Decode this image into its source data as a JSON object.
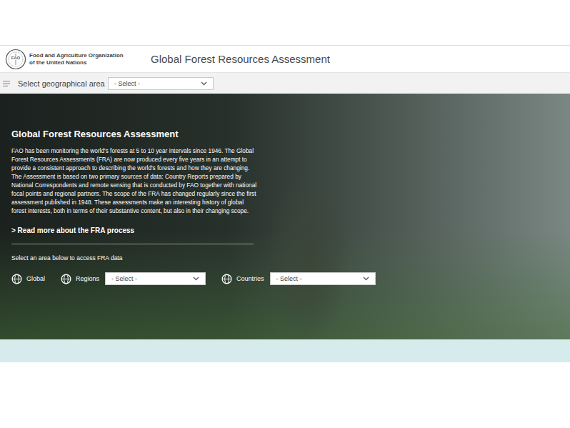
{
  "header": {
    "logo": "FAO",
    "organization": [
      "Food and Agriculture Organization",
      "of the United Nations"
    ],
    "title": "Global Forest Resources Assessment"
  },
  "toolbar": {
    "label": "Select geographical area",
    "select": "- Select -"
  },
  "hero": {
    "title": "Global Forest Resources Assessment",
    "paragraph": "FAO has been monitoring the world's forests at 5 to 10 year intervals since 1946. The Global Forest Resources Assessments (FRA) are now produced every five years in an attempt to provide a consistent approach to describing the world's forests and how they are changing. The Assessment is based on two primary sources of data: Country Reports prepared by National Correspondents and remote sensing that is conducted by FAO together with national focal points and regional partners. The scope of the FRA has changed regularly since the first assessment published in 1948. These assessments make an interesting history of global forest interests, both in terms of their substantive content, but also in their changing scope.",
    "link": "> Read more about the FRA process",
    "prompt": "Select an area below to access FRA data",
    "areas": [
      {
        "label": "Global",
        "kind": "link"
      },
      {
        "label": "Regions",
        "kind": "select",
        "value": "- Select -"
      },
      {
        "label": "Countries",
        "kind": "select",
        "value": "- Select -"
      }
    ]
  }
}
